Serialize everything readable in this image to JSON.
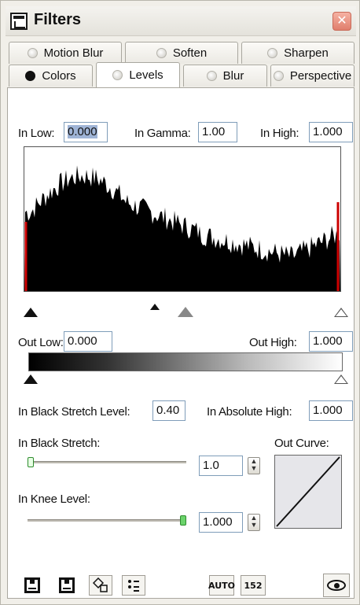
{
  "window": {
    "title": "Filters",
    "close_glyph": "✕"
  },
  "tabs_top": [
    {
      "label": "Motion Blur",
      "radio": false
    },
    {
      "label": "Soften",
      "radio": false
    },
    {
      "label": "Sharpen",
      "radio": false
    }
  ],
  "tabs_bottom": [
    {
      "label": "Colors",
      "radio": true
    },
    {
      "label": "Levels",
      "radio": false,
      "active": true
    },
    {
      "label": "Blur",
      "radio": false
    },
    {
      "label": "Perspective",
      "radio": false
    }
  ],
  "levels": {
    "in_low_label": "In Low:",
    "in_low_value": "0.000",
    "in_gamma_label": "In Gamma:",
    "in_gamma_value": "1.00",
    "in_high_label": "In High:",
    "in_high_value": "1.000",
    "out_low_label": "Out Low:",
    "out_low_value": "0.000",
    "out_high_label": "Out High:",
    "out_high_value": "1.000",
    "black_stretch_level_label": "In Black Stretch Level:",
    "black_stretch_level_value": "0.40",
    "absolute_high_label": "In Absolute High:",
    "absolute_high_value": "1.000",
    "black_stretch_label": "In Black Stretch:",
    "black_stretch_value": "1.0",
    "black_stretch_fraction": 0.0,
    "knee_level_label": "In Knee Level:",
    "knee_level_value": "1.000",
    "knee_level_fraction": 1.0,
    "out_curve_label": "Out Curve:"
  },
  "toolbar": {
    "auto_label": "AUTO",
    "btn_152_label": "152"
  },
  "colors": {
    "accent_green": "#2e8b2e",
    "clip_red": "#cc0000",
    "close_red": "#e07e6c"
  },
  "icons": [
    "filters-window-icon",
    "close-icon",
    "save-preset-icon",
    "load-preset-icon",
    "shape-tool-icon",
    "options-icon",
    "preview-eye-icon"
  ]
}
